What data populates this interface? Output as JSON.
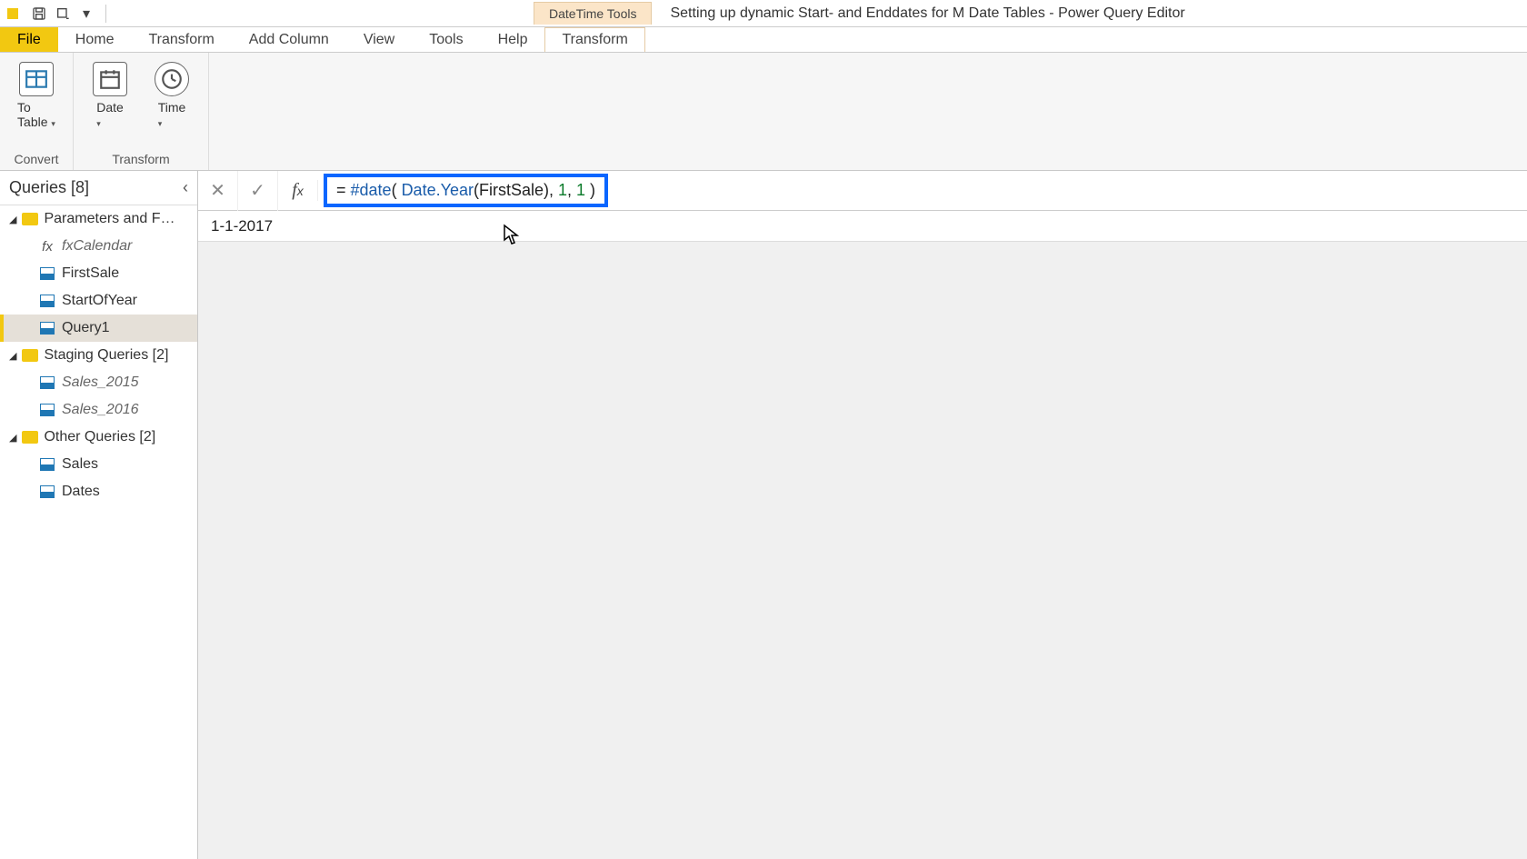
{
  "titlebar": {
    "context_tool_label": "DateTime Tools",
    "window_title": "Setting up dynamic Start- and Enddates for M Date Tables - Power Query Editor"
  },
  "ribbon": {
    "tabs": [
      "File",
      "Home",
      "Transform",
      "Add Column",
      "View",
      "Tools",
      "Help",
      "Transform"
    ],
    "active_context_tab_index": 7,
    "groups": {
      "convert": {
        "label": "Convert",
        "to_table": "To\nTable"
      },
      "transform": {
        "label": "Transform",
        "date": "Date",
        "time": "Time"
      }
    }
  },
  "queries": {
    "header": "Queries [8]",
    "groups": [
      {
        "label": "Parameters and Fu...",
        "items": [
          {
            "name": "fxCalendar",
            "type": "fx",
            "italic": true
          },
          {
            "name": "FirstSale",
            "type": "table"
          },
          {
            "name": "StartOfYear",
            "type": "table"
          },
          {
            "name": "Query1",
            "type": "table",
            "selected": true
          }
        ]
      },
      {
        "label": "Staging Queries [2]",
        "items": [
          {
            "name": "Sales_2015",
            "type": "table",
            "italic": true
          },
          {
            "name": "Sales_2016",
            "type": "table",
            "italic": true
          }
        ]
      },
      {
        "label": "Other Queries [2]",
        "items": [
          {
            "name": "Sales",
            "type": "table"
          },
          {
            "name": "Dates",
            "type": "table"
          }
        ]
      }
    ]
  },
  "formula": {
    "prefix": "= ",
    "fn1": "#date",
    "open": "( ",
    "fn2": "Date.Year",
    "open2": "(",
    "arg": "FirstSale",
    "close2": "), ",
    "num1": "1",
    "sep": ", ",
    "num2": "1",
    "close": " )"
  },
  "result": "1-1-2017"
}
